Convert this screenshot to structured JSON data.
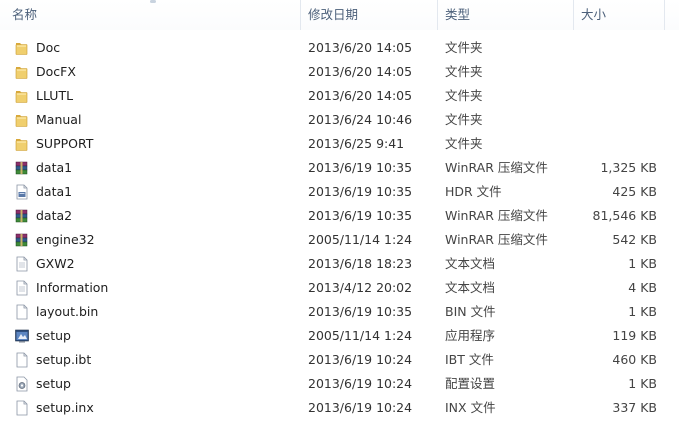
{
  "columns": {
    "name": "名称",
    "modified": "修改日期",
    "type": "类型",
    "size": "大小"
  },
  "files": [
    {
      "name": "Doc",
      "modified": "2013/6/20 14:05",
      "type": "文件夹",
      "size": "",
      "icon": "folder-icon"
    },
    {
      "name": "DocFX",
      "modified": "2013/6/20 14:05",
      "type": "文件夹",
      "size": "",
      "icon": "folder-icon"
    },
    {
      "name": "LLUTL",
      "modified": "2013/6/20 14:05",
      "type": "文件夹",
      "size": "",
      "icon": "folder-icon"
    },
    {
      "name": "Manual",
      "modified": "2013/6/24 10:46",
      "type": "文件夹",
      "size": "",
      "icon": "folder-icon"
    },
    {
      "name": "SUPPORT",
      "modified": "2013/6/25 9:41",
      "type": "文件夹",
      "size": "",
      "icon": "folder-icon"
    },
    {
      "name": "data1",
      "modified": "2013/6/19 10:35",
      "type": "WinRAR 压缩文件",
      "size": "1,325 KB",
      "icon": "winrar-archive-icon"
    },
    {
      "name": "data1",
      "modified": "2013/6/19 10:35",
      "type": "HDR 文件",
      "size": "425 KB",
      "icon": "hdr-file-icon"
    },
    {
      "name": "data2",
      "modified": "2013/6/19 10:35",
      "type": "WinRAR 压缩文件",
      "size": "81,546 KB",
      "icon": "winrar-archive-icon"
    },
    {
      "name": "engine32",
      "modified": "2005/11/14 1:24",
      "type": "WinRAR 压缩文件",
      "size": "542 KB",
      "icon": "winrar-archive-icon"
    },
    {
      "name": "GXW2",
      "modified": "2013/6/18 18:23",
      "type": "文本文档",
      "size": "1 KB",
      "icon": "text-document-icon"
    },
    {
      "name": "Information",
      "modified": "2013/4/12 20:02",
      "type": "文本文档",
      "size": "4 KB",
      "icon": "text-document-icon"
    },
    {
      "name": "layout.bin",
      "modified": "2013/6/19 10:35",
      "type": "BIN 文件",
      "size": "1 KB",
      "icon": "blank-file-icon"
    },
    {
      "name": "setup",
      "modified": "2005/11/14 1:24",
      "type": "应用程序",
      "size": "119 KB",
      "icon": "setup-application-icon"
    },
    {
      "name": "setup.ibt",
      "modified": "2013/6/19 10:24",
      "type": "IBT 文件",
      "size": "460 KB",
      "icon": "blank-file-icon"
    },
    {
      "name": "setup",
      "modified": "2013/6/19 10:24",
      "type": "配置设置",
      "size": "1 KB",
      "icon": "config-settings-icon"
    },
    {
      "name": "setup.inx",
      "modified": "2013/6/19 10:24",
      "type": "INX 文件",
      "size": "337 KB",
      "icon": "blank-file-icon"
    }
  ],
  "colors": {
    "header_text": "#4c607a",
    "folder": "#e8c15a",
    "winrar": "#7a2d5c"
  }
}
